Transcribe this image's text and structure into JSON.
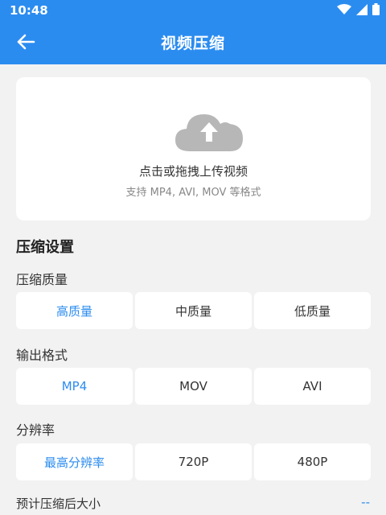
{
  "status": {
    "time": "10:48"
  },
  "appbar": {
    "title": "视频压缩"
  },
  "upload": {
    "main_text": "点击或拖拽上传视频",
    "sub_text": "支持 MP4, AVI, MOV 等格式"
  },
  "settings": {
    "title": "压缩设置",
    "quality": {
      "label": "压缩质量",
      "options": [
        "高质量",
        "中质量",
        "低质量"
      ],
      "selected": "高质量"
    },
    "format": {
      "label": "输出格式",
      "options": [
        "MP4",
        "MOV",
        "AVI"
      ],
      "selected": "MP4"
    },
    "resolution": {
      "label": "分辨率",
      "options": [
        "最高分辨率",
        "720P",
        "480P"
      ],
      "selected": "最高分辨率"
    },
    "estimate": {
      "label": "预计压缩后大小",
      "value": "--"
    }
  },
  "colors": {
    "accent": "#2b8cf0",
    "background": "#f2f2f2"
  },
  "icons": [
    "back-arrow-icon",
    "wifi-icon",
    "signal-icon",
    "battery-icon",
    "cloud-upload-icon"
  ]
}
